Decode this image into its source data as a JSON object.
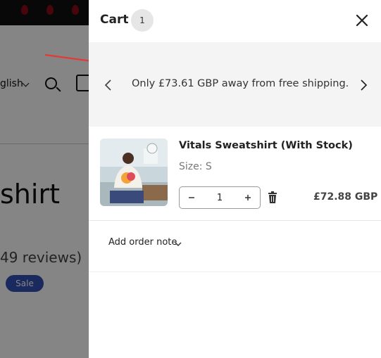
{
  "background": {
    "language_label": "glish",
    "product_title": "shirt",
    "reviews": "49 reviews)",
    "sale_badge": "Sale"
  },
  "cart": {
    "title": "Cart",
    "count": "1",
    "shipping_message": "Only £73.61 GBP away from free shipping.",
    "item": {
      "name": "Vitals Sweatshirt (With Stock)",
      "size_label": "Size: S",
      "quantity": "1",
      "price": "£72.88 GBP"
    },
    "order_note_label": "Add order note"
  },
  "colors": {
    "sale_badge": "#334fb4",
    "annotation_arrow": "#e53935",
    "drawer_bg": "#ffffff",
    "shipping_bar_bg": "#f4f4f4"
  },
  "icons": {
    "close": "close-icon",
    "prev": "chevron-left-icon",
    "next": "chevron-right-icon",
    "minus": "minus-icon",
    "plus": "plus-icon",
    "delete": "trash-icon",
    "note_toggle": "chevron-down-icon"
  }
}
